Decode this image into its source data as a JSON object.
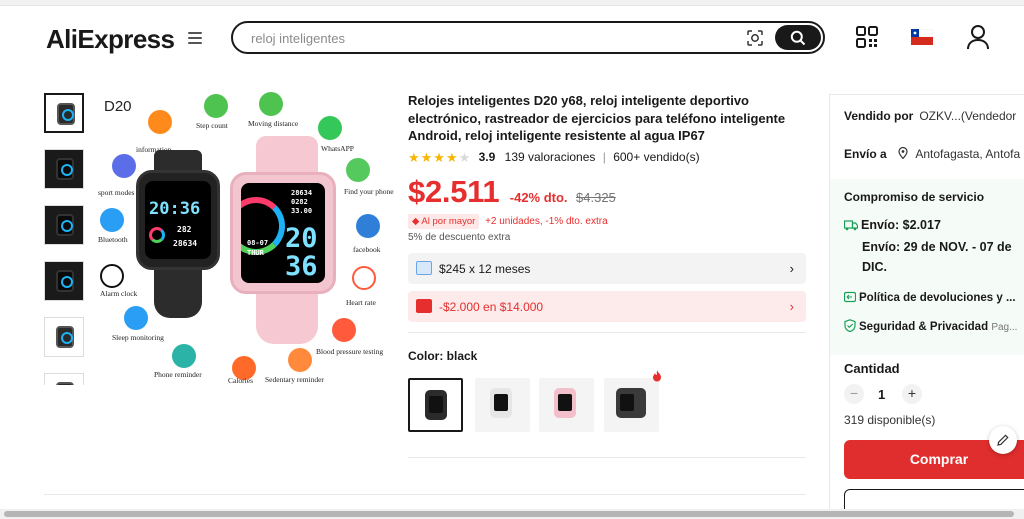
{
  "header": {
    "logo": "AliExpress",
    "search_placeholder": "reloj inteligentes"
  },
  "gallery": {
    "main_label": "D20",
    "features": [
      "Step count",
      "Moving distance",
      "WhatsAPP",
      "Find your phone",
      "facebook",
      "Heart rate",
      "Blood pressure testing",
      "Sedentary reminder",
      "Calories",
      "Phone reminder",
      "Sleep monitoring",
      "Alarm clock",
      "Bluetooth",
      "sport modes",
      "information"
    ],
    "black_watch": {
      "time_top": "20:36",
      "line1": "282",
      "line2": "28634"
    },
    "pink_watch": {
      "top": "28634",
      "mid1": "0282",
      "mid2": "33.00",
      "date": "08-07",
      "day": "THUR",
      "hour": "20",
      "min": "36"
    }
  },
  "product": {
    "title": "Relojes inteligentes D20 y68, reloj inteligente deportivo electrónico, rastreador de ejercicios para teléfono inteligente Android, reloj inteligente resistente al agua IP67",
    "rating": "3.9",
    "ratings_count": "139 valoraciones",
    "sold": "600+ vendido(s)",
    "price": "$2.511",
    "discount": "-42% dto.",
    "old_price": "$4.325",
    "bulk_badge": "Al por mayor",
    "bulk_text": "+2 unidades, -1% dto. extra",
    "extra_discount": "5% de descuento extra",
    "installments": "$245 x 12 meses",
    "coupon": "-$2.000 en $14.000",
    "color_label": "Color: black",
    "swatches": [
      "black",
      "white",
      "pink",
      "black-gray"
    ]
  },
  "panel": {
    "sold_by_key": "Vendido por",
    "sold_by_val": "OZKV...(Vendedor",
    "ship_to_key": "Envío a",
    "ship_to_val": "Antofagasta, Antofa",
    "service_title": "Compromiso de servicio",
    "shipping_cost": "Envío: $2.017",
    "shipping_date": "Envío: 29 de NOV. - 07 de",
    "shipping_date2": "DIC.",
    "returns": "Política de devoluciones y ...",
    "security": "Seguridad & Privacidad",
    "security_more": "Pag...",
    "qty_label": "Cantidad",
    "qty_value": "1",
    "available": "319 disponible(s)",
    "buy_label": "Comprar"
  },
  "colors": {
    "accent": "#e62e2e",
    "service_green": "#18a058",
    "star": "#f7b500"
  }
}
